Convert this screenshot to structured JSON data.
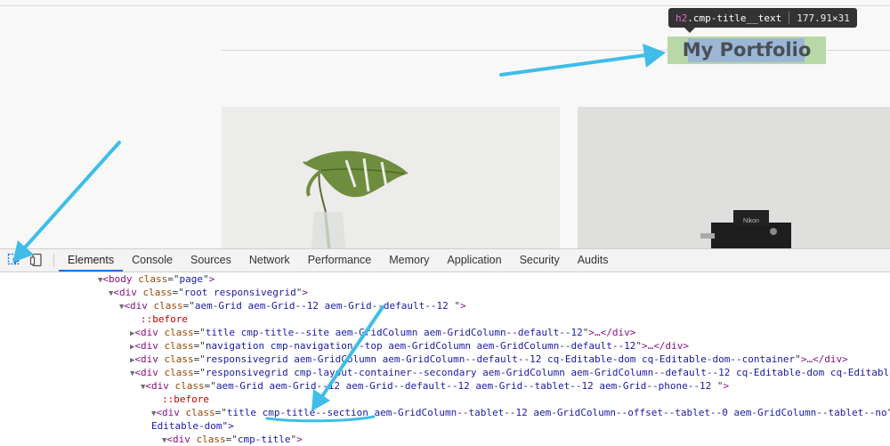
{
  "page": {
    "heading": "My Portfolio"
  },
  "tooltip": {
    "tag": "h2",
    "class_selector": ".cmp-title__text",
    "dims": "177.91×31"
  },
  "devtools": {
    "tabs": [
      "Elements",
      "Console",
      "Sources",
      "Network",
      "Performance",
      "Memory",
      "Application",
      "Security",
      "Audits"
    ],
    "active_tab": "Elements",
    "dom_lines": [
      {
        "arrow": "▼",
        "tag": "body",
        "attr": "class",
        "value": "page",
        "tail": ""
      },
      {
        "arrow": "▼",
        "tag": "div",
        "attr": "class",
        "value": "root responsivegrid",
        "tail": ""
      },
      {
        "arrow": "▼",
        "tag": "div",
        "attr": "class",
        "value": "aem-Grid aem-Grid--12 aem-Grid--default--12 ",
        "tail": ""
      },
      {
        "arrow": "",
        "pseudo": "::before"
      },
      {
        "arrow": "▶",
        "tag": "div",
        "attr": "class",
        "value": "title cmp-title--site aem-GridColumn aem-GridColumn--default--12",
        "tail": "…</div>"
      },
      {
        "arrow": "▶",
        "tag": "div",
        "attr": "class",
        "value": "navigation cmp-navigation--top aem-GridColumn aem-GridColumn--default--12",
        "tail": "…</div>"
      },
      {
        "arrow": "▶",
        "tag": "div",
        "attr": "class",
        "value": "responsivegrid aem-GridColumn aem-GridColumn--default--12 cq-Editable-dom cq-Editable-dom--container",
        "tail": "…</div>"
      },
      {
        "arrow": "▼",
        "tag": "div",
        "attr": "class",
        "value": "responsivegrid cmp-layout-container--secondary aem-GridColumn aem-GridColumn--default--12 cq-Editable-dom cq-Editable",
        "tail": ""
      },
      {
        "arrow": "▼",
        "tag": "div",
        "attr": "class",
        "value": "aem-Grid aem-Grid--12 aem-Grid--default--12 aem-Grid--tablet--12 aem-Grid--phone--12 ",
        "tail": ""
      },
      {
        "arrow": "",
        "pseudo": "::before"
      },
      {
        "arrow": "▼",
        "tag": "div",
        "attr": "class",
        "value_parts": [
          "title ",
          "cmp-title--section",
          " aem-GridColumn--tablet--12 aem-GridColumn--offset--tablet--0 aem-GridColumn--tablet--no"
        ],
        "tail": ""
      },
      {
        "continuation": "Editable-dom\">"
      },
      {
        "arrow": "▼",
        "tag": "div",
        "attr": "class",
        "value": "cmp-title",
        "tail": ""
      }
    ]
  },
  "colors": {
    "accent_arrow": "#3fbde8",
    "highlight_margin": "#b9d8a7",
    "highlight_content": "#9bb7d4",
    "tab_active_underline": "#1a73e8"
  }
}
